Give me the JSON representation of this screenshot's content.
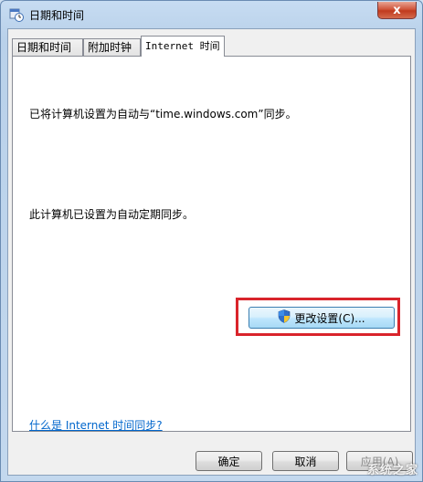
{
  "window": {
    "title": "日期和时间",
    "close_label": "x",
    "icon": "date-time-icon"
  },
  "tabs": [
    {
      "label": "日期和时间",
      "active": false
    },
    {
      "label": "附加时钟",
      "active": false
    },
    {
      "label": "Internet 时间",
      "active": true
    }
  ],
  "panel": {
    "sync_text": "已将计算机设置为自动与“time.windows.com”同步。",
    "status_text": "此计算机已设置为自动定期同步。",
    "change_button": "更改设置(C)...",
    "change_icon": "uac-shield-icon",
    "help_link": "什么是 Internet 时间同步?"
  },
  "footer": {
    "ok": "确定",
    "cancel": "取消",
    "apply": "应用(A)"
  },
  "watermark": "系统之家",
  "colors": {
    "highlight_border": "#d9242b",
    "link": "#0066cc"
  }
}
